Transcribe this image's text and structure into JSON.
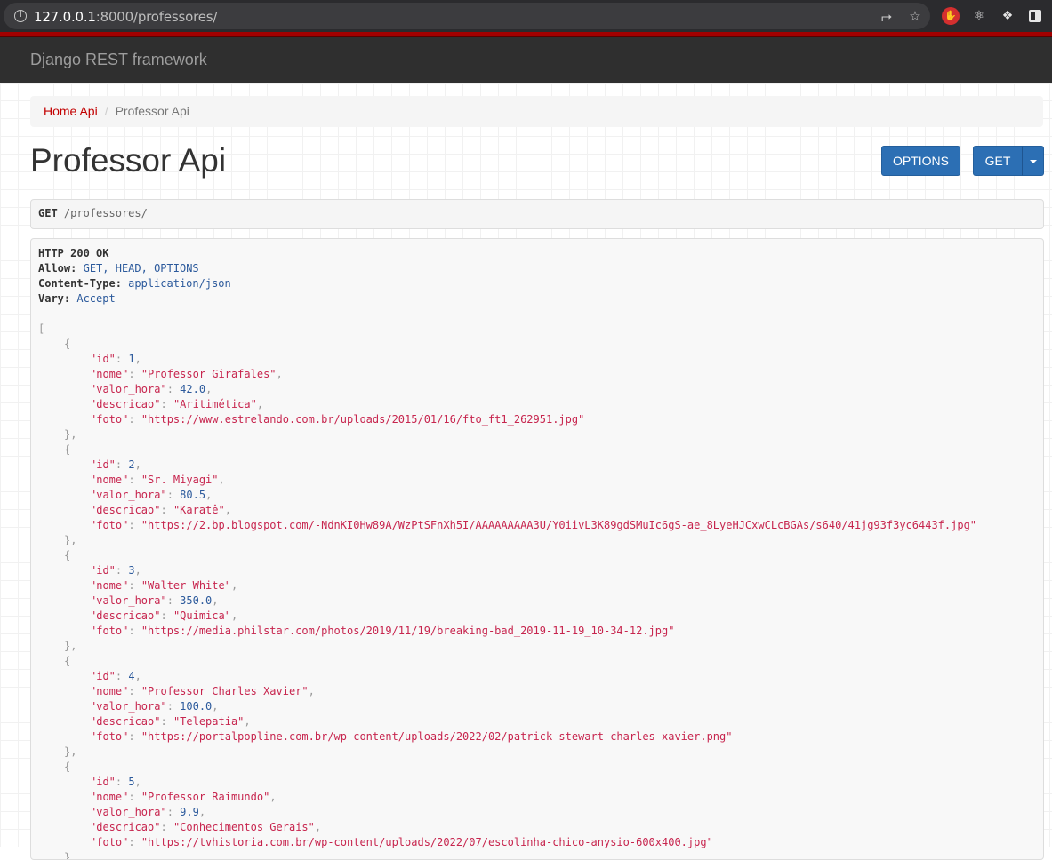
{
  "browser": {
    "url_host": "127.0.0.1",
    "url_rest": ":8000/professores/"
  },
  "navbar": {
    "brand": "Django REST framework"
  },
  "breadcrumb": {
    "home": "Home Api",
    "separator": "/",
    "current": "Professor Api"
  },
  "page": {
    "title": "Professor Api"
  },
  "buttons": {
    "options": "OPTIONS",
    "get": "GET"
  },
  "request": {
    "method": "GET",
    "path": "/professores/"
  },
  "response": {
    "status_line": "HTTP 200 OK",
    "headers": [
      {
        "name": "Allow:",
        "value": "GET, HEAD, OPTIONS"
      },
      {
        "name": "Content-Type:",
        "value": "application/json"
      },
      {
        "name": "Vary:",
        "value": "Accept"
      }
    ],
    "professores": [
      {
        "id": "1",
        "nome": "\"Professor Girafales\"",
        "valor_hora": "42.0",
        "descricao": "\"Aritimética\"",
        "foto": "\"https://www.estrelando.com.br/uploads/2015/01/16/fto_ft1_262951.jpg\""
      },
      {
        "id": "2",
        "nome": "\"Sr. Miyagi\"",
        "valor_hora": "80.5",
        "descricao": "\"Karatê\"",
        "foto": "\"https://2.bp.blogspot.com/-NdnKI0Hw89A/WzPtSFnXh5I/AAAAAAAAA3U/Y0iivL3K89gdSMuIc6gS-ae_8LyeHJCxwCLcBGAs/s640/41jg93f3yc6443f.jpg\""
      },
      {
        "id": "3",
        "nome": "\"Walter White\"",
        "valor_hora": "350.0",
        "descricao": "\"Quimica\"",
        "foto": "\"https://media.philstar.com/photos/2019/11/19/breaking-bad_2019-11-19_10-34-12.jpg\""
      },
      {
        "id": "4",
        "nome": "\"Professor Charles Xavier\"",
        "valor_hora": "100.0",
        "descricao": "\"Telepatia\"",
        "foto": "\"https://portalpopline.com.br/wp-content/uploads/2022/02/patrick-stewart-charles-xavier.png\""
      },
      {
        "id": "5",
        "nome": "\"Professor Raimundo\"",
        "valor_hora": "9.9",
        "descricao": "\"Conhecimentos Gerais\"",
        "foto": "\"https://tvhistoria.com.br/wp-content/uploads/2022/07/escolinha-chico-anysio-600x400.jpg\""
      }
    ]
  }
}
